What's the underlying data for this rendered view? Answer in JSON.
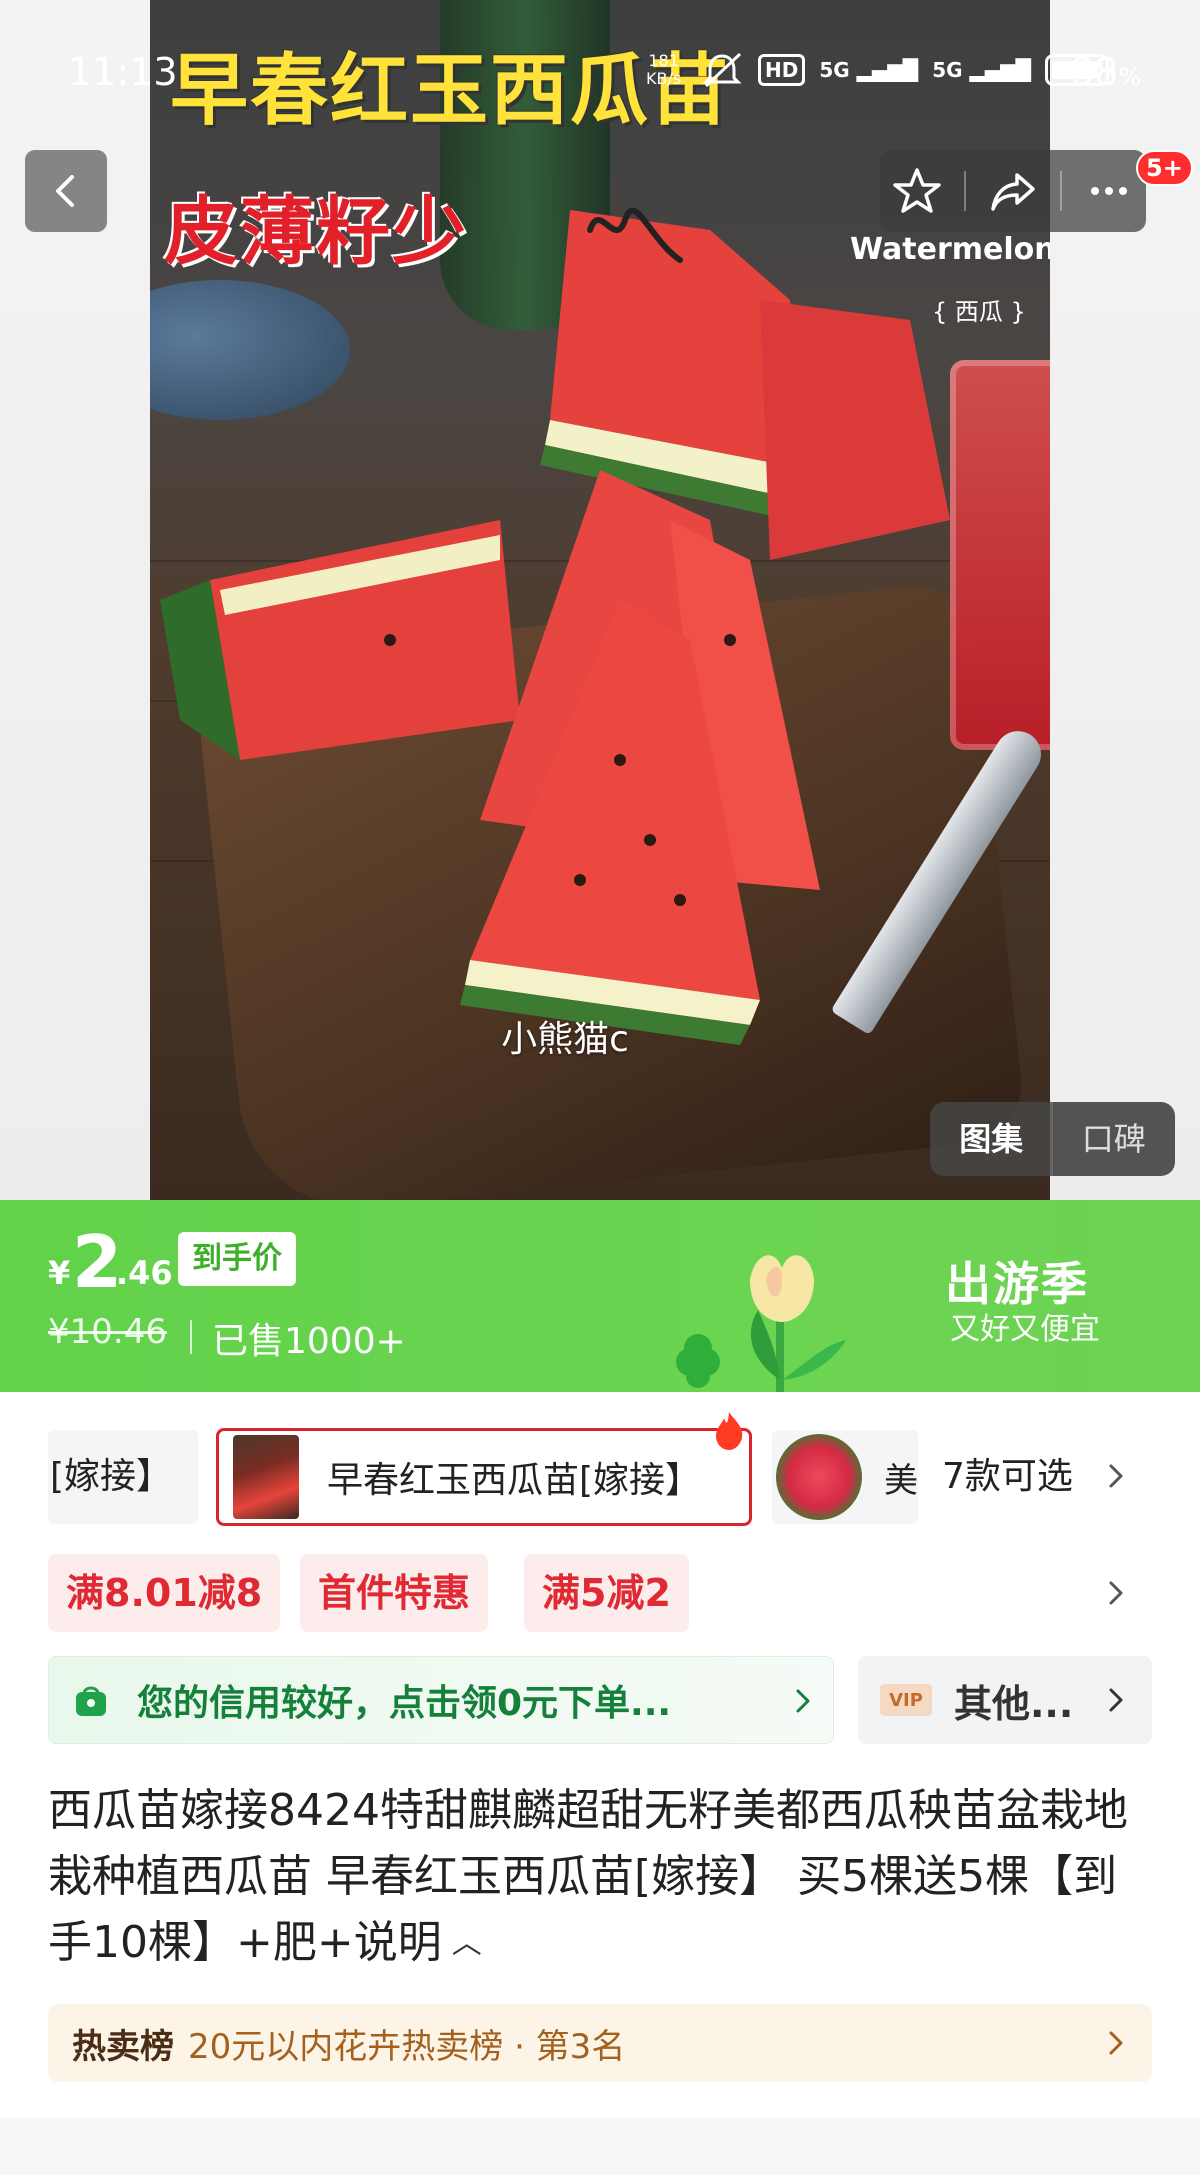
{
  "status_bar": {
    "time": "11:13",
    "net_speed_value": "181",
    "net_speed_unit": "KB/s",
    "sim1_label": "5G",
    "sim2_label": "5G",
    "hd_label": "HD",
    "battery_percent": "88"
  },
  "hero": {
    "title": "早春红玉西瓜苗",
    "subtitle": "皮薄籽少",
    "english_label": "Watermelon",
    "chinese_label": "{ 西瓜 }",
    "watermark": "小熊猫c"
  },
  "nav": {
    "badge": "5+"
  },
  "gallery_toggle": {
    "items": [
      "图集",
      "口碑"
    ],
    "active": "图集"
  },
  "price_banner": {
    "currency": "¥",
    "price_int": "2",
    "price_dec": ".46",
    "price_tag": "到手价",
    "original_price": "¥10.46",
    "sold": "已售1000+",
    "promo_title": "出游季",
    "promo_sub": "又好又便宜"
  },
  "sku": {
    "partial_label": "[嫁接】",
    "selected_label": "早春红玉西瓜苗[嫁接】",
    "third_label": "美",
    "count": "7款可选"
  },
  "coupons": [
    "满8.01减8",
    "首件特惠",
    "满5减2"
  ],
  "credit": {
    "text": "您的信用较好，点击领0元下单...",
    "vip_badge": "VIP",
    "vip_text": "其他..."
  },
  "product": {
    "title": "西瓜苗嫁接8424特甜麒麟超甜无籽美都西瓜秧苗盆栽地栽种植西瓜苗 早春红玉西瓜苗[嫁接】 买5棵送5棵【到手10棵】+肥+说明"
  },
  "ranking": {
    "label": "热卖榜",
    "text": "20元以内花卉热卖榜 · 第3名"
  },
  "colors": {
    "price_green": "#62d24a",
    "coupon_red": "#e02a33",
    "credit_green": "#15803a",
    "rank_brown": "#a4611d"
  },
  "icons": [
    "back-icon",
    "star-icon",
    "share-icon",
    "more-icon",
    "hot-icon",
    "bag-icon",
    "chevron-right-icon",
    "chevron-up-icon"
  ]
}
